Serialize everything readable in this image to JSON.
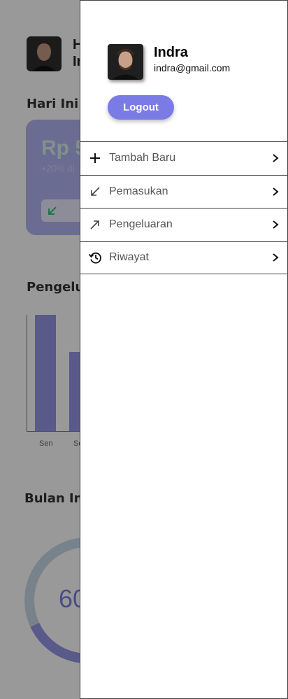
{
  "background": {
    "greeting_line1": "H",
    "greeting_line2": "In",
    "today_title": "Hari Ini",
    "today_amount": "Rp 5",
    "today_change": "+20% di",
    "expense_title": "Pengelua",
    "chart_ticks": [
      "Sen",
      "Se"
    ],
    "month_title": "Bulan Ini",
    "donut_value": "60"
  },
  "chart_data": {
    "type": "bar",
    "categories": [
      "Sen",
      "Se"
    ],
    "values": [
      100,
      68
    ]
  },
  "drawer": {
    "user_name": "Indra",
    "user_email": "indra@gmail.com",
    "logout_label": "Logout",
    "accent_color": "#7b7be6",
    "menu": [
      {
        "label": "Tambah Baru",
        "icon": "plus-icon"
      },
      {
        "label": "Pemasukan",
        "icon": "arrow-down-left-icon"
      },
      {
        "label": "Pengeluaran",
        "icon": "arrow-up-right-icon"
      },
      {
        "label": "Riwayat",
        "icon": "history-icon"
      }
    ]
  }
}
